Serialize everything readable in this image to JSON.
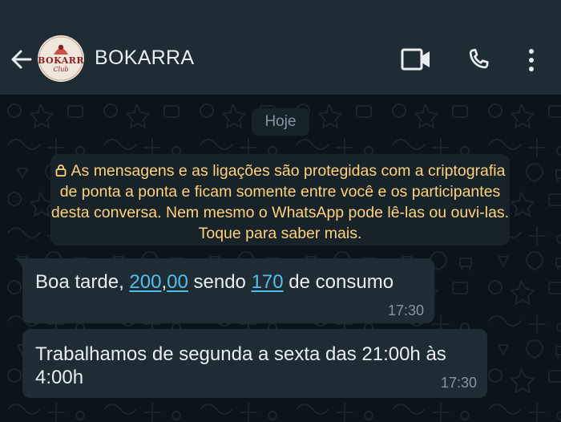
{
  "header": {
    "title": "BOKARRA",
    "avatar_text": "BOKARRA",
    "avatar_subtext": "Club",
    "icons": [
      "back-arrow-icon",
      "video-call-icon",
      "voice-call-icon",
      "more-options-icon"
    ]
  },
  "chat": {
    "date_label": "Hoje",
    "encryption_notice": "As mensagens e as ligações são protegidas com a criptografia de ponta a ponta e ficam somente entre você e os participantes desta conversa. Nem mesmo o WhatsApp pode lê-las ou ouvi-las. Toque para saber mais.",
    "messages": [
      {
        "parts": [
          "Boa tarde, ",
          "200",
          ",",
          "00",
          " sendo ",
          "170",
          " de consumo"
        ],
        "time": "17:30"
      },
      {
        "text": "Trabalhamos de segunda a sexta das 21:00h às 4:00h",
        "time": "17:30"
      }
    ]
  },
  "colors": {
    "header_bg": "#1f2c34",
    "chat_bg": "#0b141a",
    "bubble_bg": "#202c33",
    "notice_text": "#ffd279",
    "link": "#53bdeb",
    "meta_text": "#8696a0"
  }
}
